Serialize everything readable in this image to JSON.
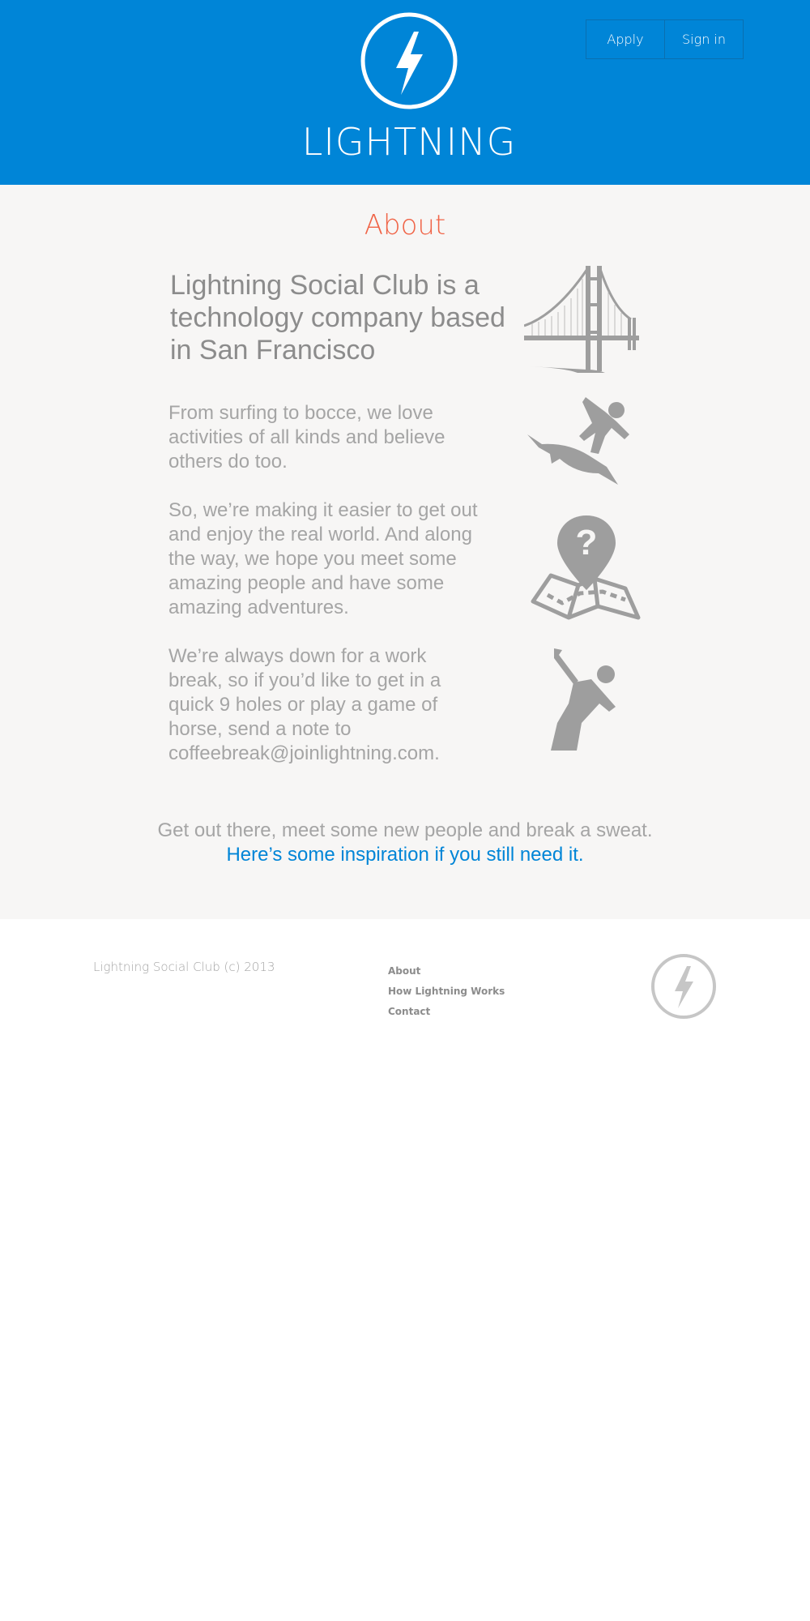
{
  "header": {
    "brand": "LIGHTNING",
    "logo_icon": "lightning-bolt-icon",
    "nav": {
      "apply": "Apply",
      "sign_in": "Sign in"
    },
    "colors": {
      "background": "#0085d7",
      "text": "#ffffff"
    }
  },
  "main": {
    "title": "About",
    "lead": "Lightning Social Club is a technology company based in San Francisco",
    "paragraphs": [
      "From surfing to bocce, we love activities of all kinds and believe others do too.",
      "So, we’re making it easier to get out and enjoy the real world. And along the way, we hope you meet some amazing people and have some amazing adventures.",
      "We’re always down for a work break, so if you’d like to get in a quick 9 holes or play a game of horse, send a note to coffeebreak@joinlightning.com."
    ],
    "icons": [
      "golden-gate-bridge-icon",
      "shark-surfer-icon",
      "map-question-icon",
      "golfer-icon"
    ],
    "closing": {
      "text": "Get out there, meet some new people and break a sweat.",
      "link": "Here’s some inspiration if you still need it."
    },
    "colors": {
      "background": "#f7f6f5",
      "title": "#f06447",
      "link": "#0085d7"
    }
  },
  "footer": {
    "copyright": "Lightning Social Club (c) 2013",
    "links": [
      "About",
      "How Lightning Works",
      "Contact"
    ],
    "logo_icon": "lightning-bolt-icon"
  }
}
